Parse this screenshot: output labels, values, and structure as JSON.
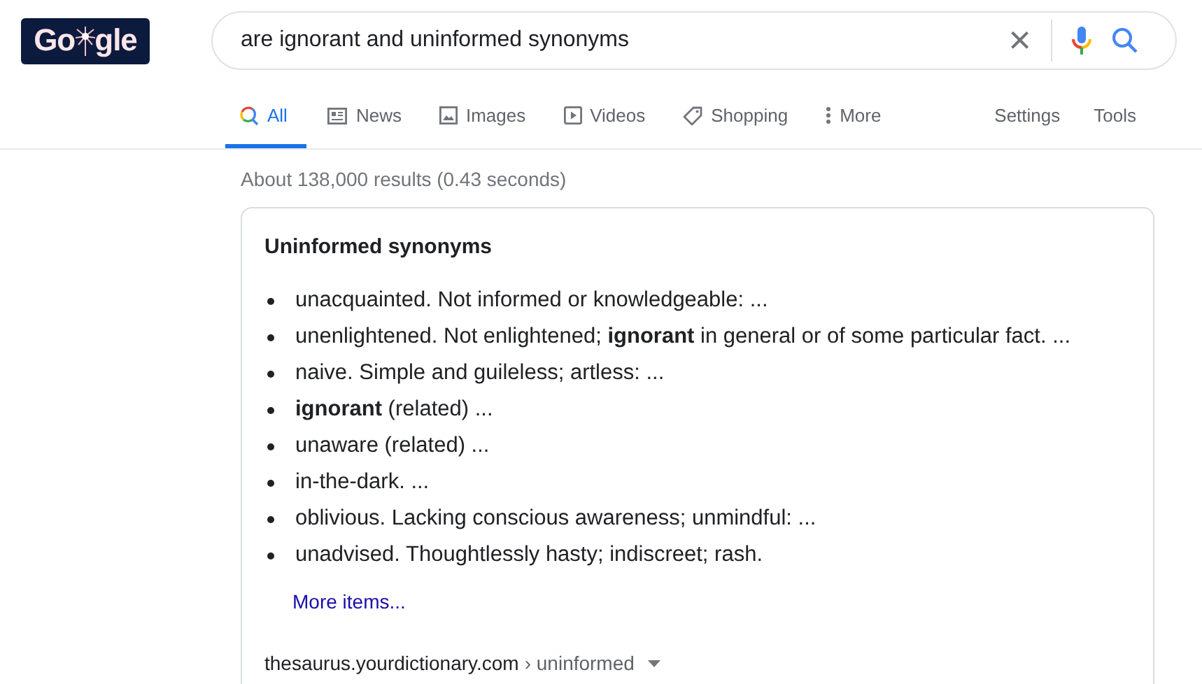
{
  "logo": {
    "text_before": "Go",
    "text_after": "gle"
  },
  "search": {
    "value": "are ignorant and uninformed synonyms",
    "clear": "×"
  },
  "tabs": [
    {
      "label": "All",
      "kind": "all",
      "selected": true
    },
    {
      "label": "News",
      "kind": "news",
      "selected": false
    },
    {
      "label": "Images",
      "kind": "images",
      "selected": false
    },
    {
      "label": "Videos",
      "kind": "videos",
      "selected": false
    },
    {
      "label": "Shopping",
      "kind": "shopping",
      "selected": false
    },
    {
      "label": "More",
      "kind": "more",
      "selected": false
    }
  ],
  "tools": [
    "Settings",
    "Tools"
  ],
  "result_stats": "About 138,000 results (0.43 seconds)",
  "snippet": {
    "title": "Uninformed synonyms",
    "items": [
      "unacquainted. Not informed or knowledgeable: ...",
      "unenlightened. Not enlightened; **ignorant** in general or of some particular fact. ...",
      "naive. Simple and guileless; artless: ...",
      "**ignorant** (related) ...",
      "unaware (related) ...",
      "in-the-dark. ...",
      "oblivious. Lacking conscious awareness; unmindful: ...",
      "unadvised. Thoughtlessly hasty; indiscreet; rash."
    ],
    "more_link": "More items...",
    "source_domain": "thesaurus.yourdictionary.com",
    "source_path": "› uninformed"
  }
}
